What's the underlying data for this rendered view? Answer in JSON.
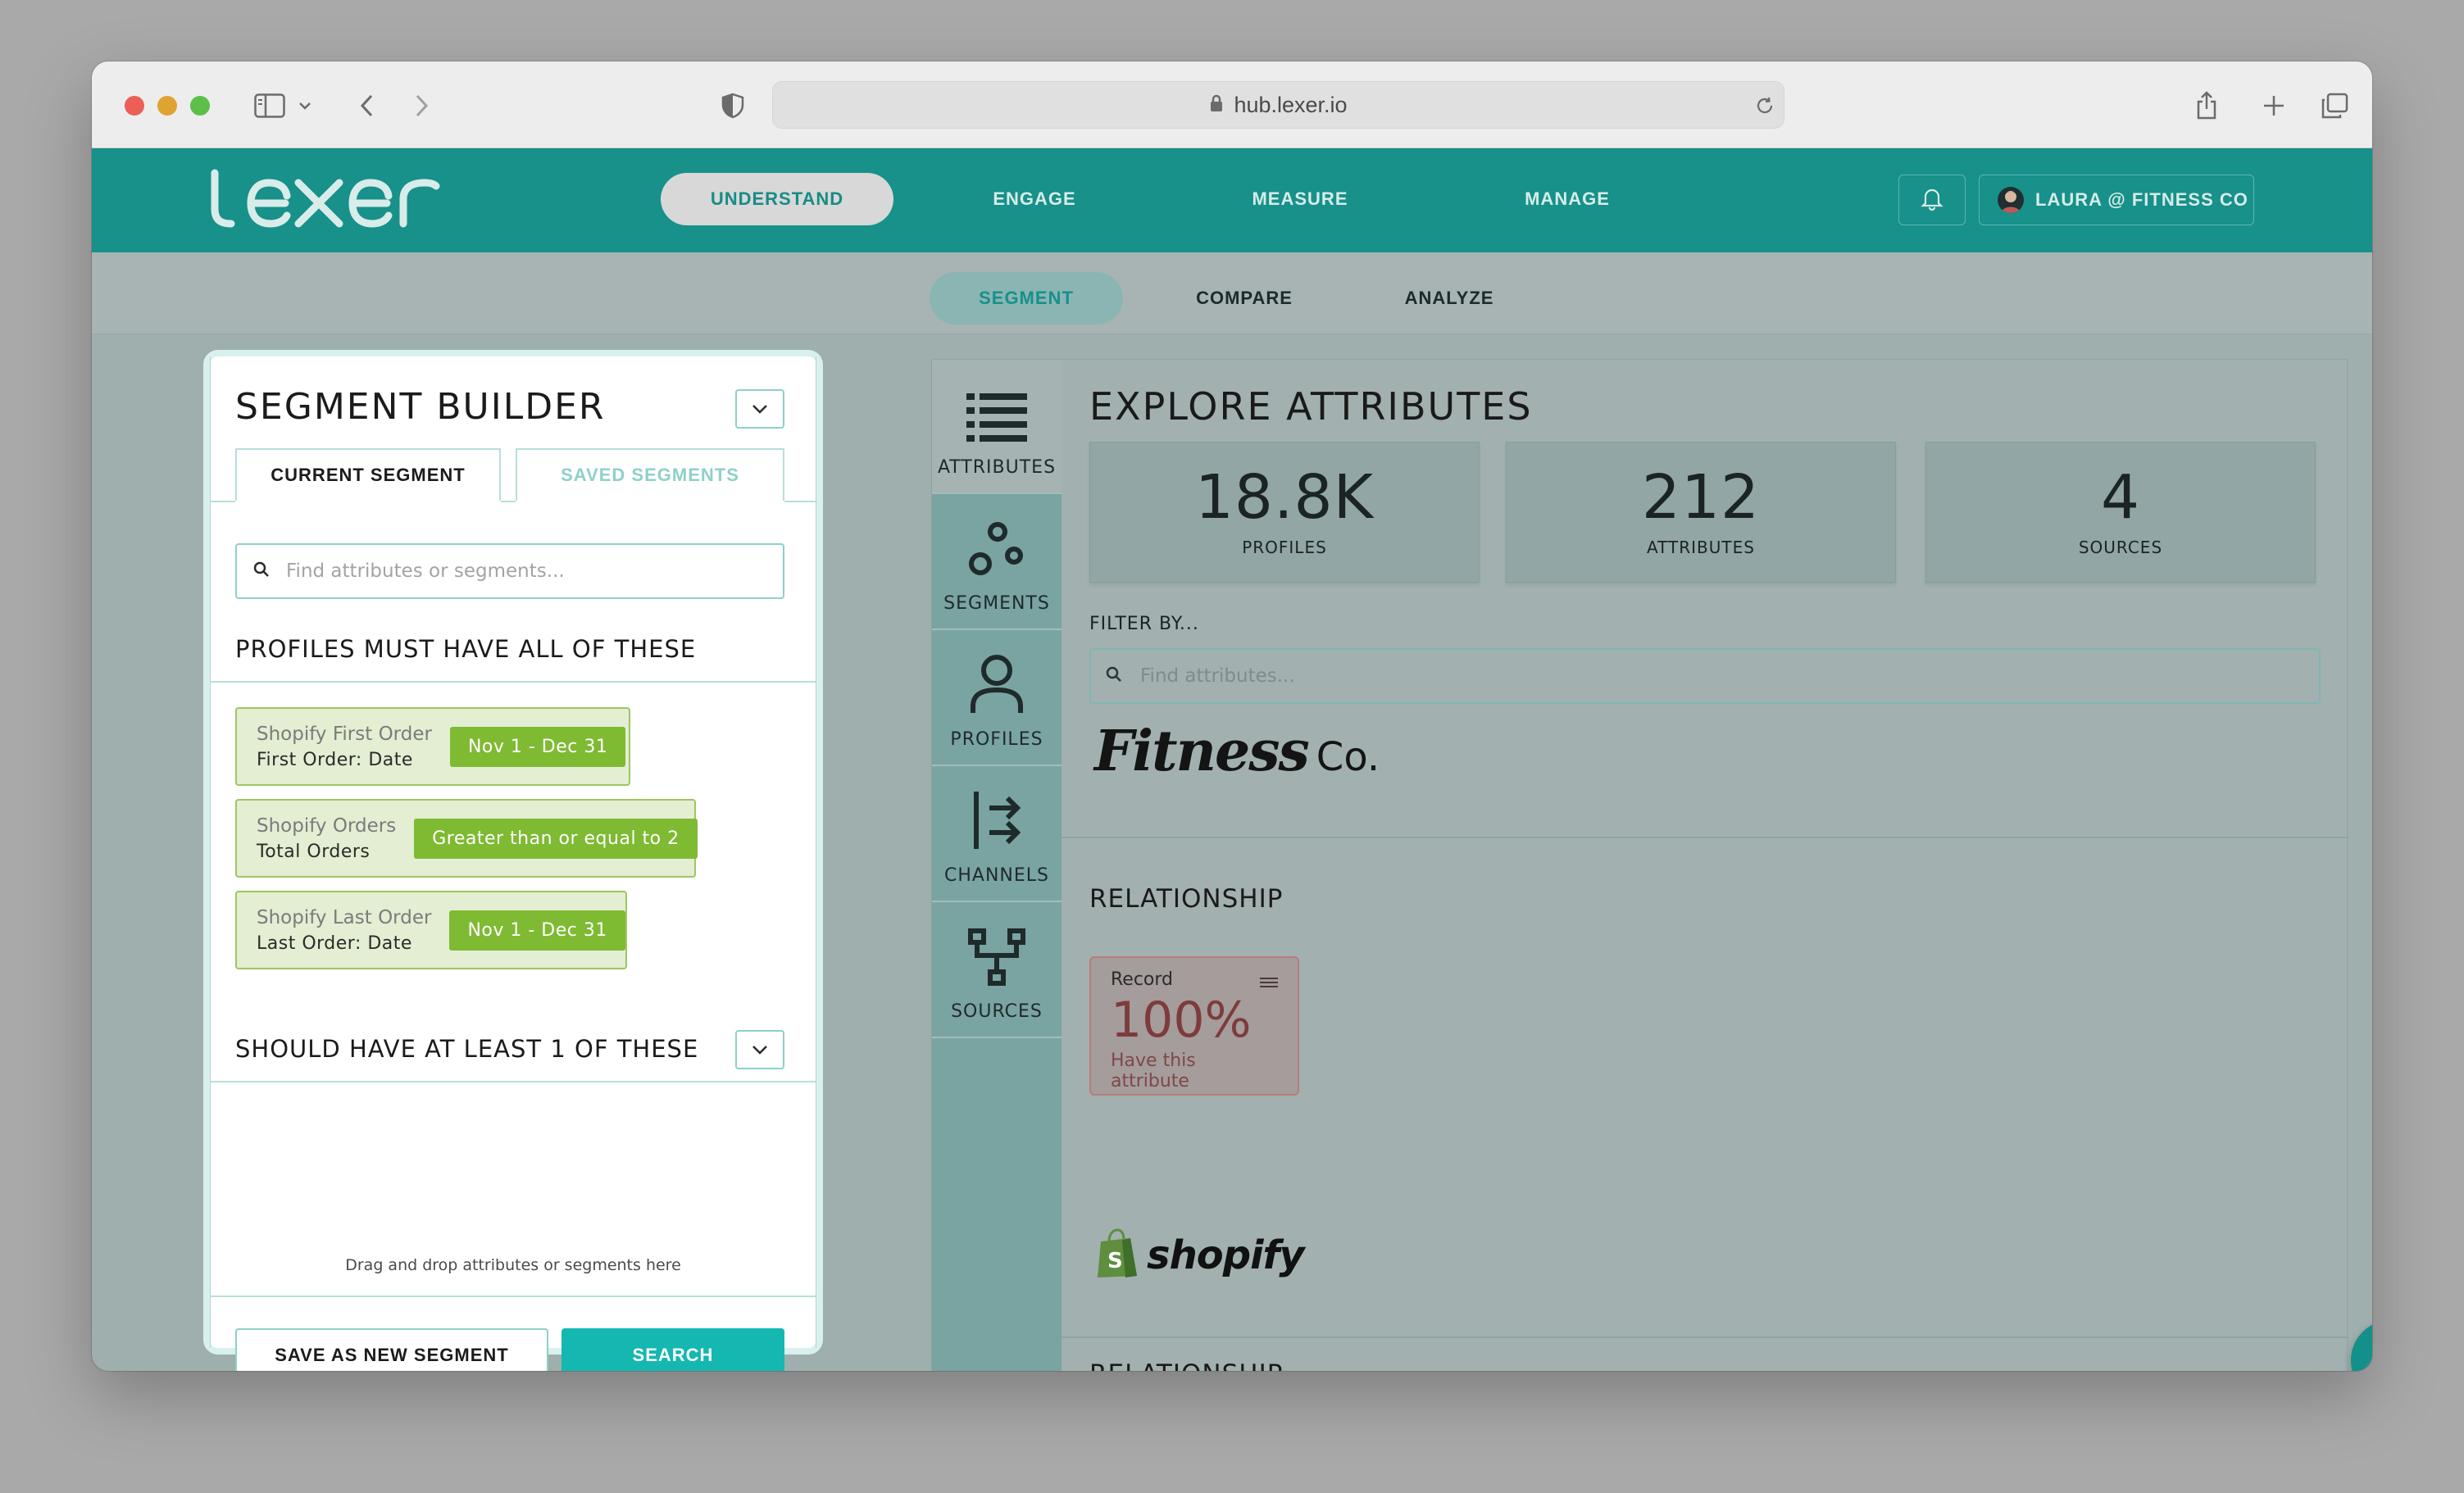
{
  "browser": {
    "url": "hub.lexer.io"
  },
  "topnav": {
    "logo_text": "lexer",
    "items": [
      {
        "label": "UNDERSTAND",
        "active": true
      },
      {
        "label": "ENGAGE",
        "active": false
      },
      {
        "label": "MEASURE",
        "active": false
      },
      {
        "label": "MANAGE",
        "active": false
      }
    ],
    "user_label": "LAURA @ FITNESS CO"
  },
  "subnav": {
    "items": [
      {
        "label": "SEGMENT",
        "active": true
      },
      {
        "label": "COMPARE",
        "active": false
      },
      {
        "label": "ANALYZE",
        "active": false
      }
    ]
  },
  "builder": {
    "title": "SEGMENT BUILDER",
    "tabs": [
      {
        "label": "CURRENT SEGMENT",
        "active": true
      },
      {
        "label": "SAVED SEGMENTS",
        "active": false
      }
    ],
    "search_placeholder": "Find attributes or segments...",
    "must_title": "PROFILES MUST HAVE ALL OF THESE",
    "conditions": [
      {
        "source": "Shopify First Order",
        "attribute": "First Order: Date",
        "value": "Nov 1 - Dec 31"
      },
      {
        "source": "Shopify Orders",
        "attribute": "Total Orders",
        "value": "Greater than or equal to 2"
      },
      {
        "source": "Shopify Last Order",
        "attribute": "Last Order: Date",
        "value": "Nov 1 - Dec 31"
      }
    ],
    "should_title": "SHOULD HAVE AT LEAST 1 OF THESE",
    "drop_hint": "Drag and drop attributes or segments here",
    "save_label": "SAVE AS NEW SEGMENT",
    "search_label": "SEARCH"
  },
  "explore": {
    "rail": [
      {
        "label": "ATTRIBUTES",
        "icon": "list-icon",
        "active": true
      },
      {
        "label": "SEGMENTS",
        "icon": "segments-icon",
        "active": false
      },
      {
        "label": "PROFILES",
        "icon": "person-icon",
        "active": false
      },
      {
        "label": "CHANNELS",
        "icon": "channels-icon",
        "active": false
      },
      {
        "label": "SOURCES",
        "icon": "sources-icon",
        "active": false
      }
    ],
    "title": "EXPLORE ATTRIBUTES",
    "stats": [
      {
        "value": "18.8K",
        "label": "PROFILES"
      },
      {
        "value": "212",
        "label": "ATTRIBUTES"
      },
      {
        "value": "4",
        "label": "SOURCES"
      }
    ],
    "filter_label": "FILTER BY...",
    "filter_placeholder": "Find attributes...",
    "brand_fitness": {
      "main": "Fitness",
      "suffix": "Co."
    },
    "relationship_title_1": "RELATIONSHIP",
    "record": {
      "label": "Record",
      "percent": "100%",
      "caption": "Have this attribute"
    },
    "shopify_wordmark": "shopify",
    "relationship_title_2": "RELATIONSHIP"
  },
  "colors": {
    "brand_teal": "#179189",
    "primary_button": "#14b8b1",
    "condition_green": "#7fba33",
    "record_red": "#7e3b3b"
  }
}
